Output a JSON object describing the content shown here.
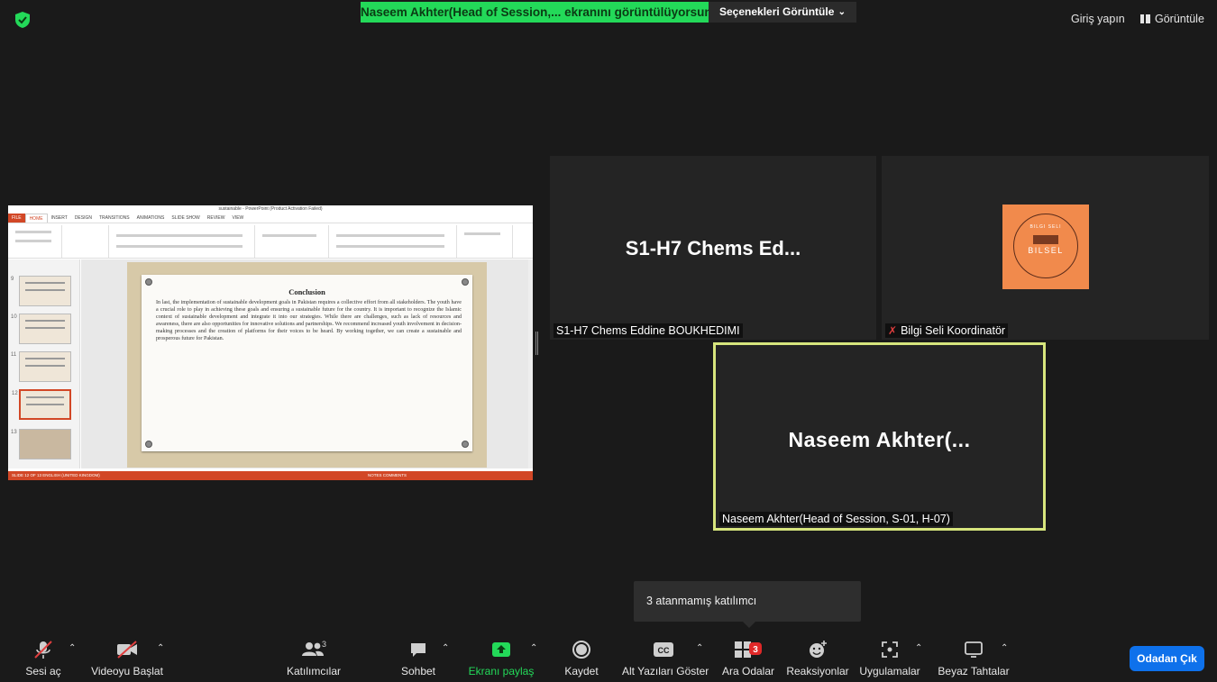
{
  "top": {
    "share_banner": "Naseem Akhter(Head of Session,... ekranını görüntülüyorsunuz",
    "view_options": "Seçenekleri Görüntüle",
    "sign_in": "Giriş yapın",
    "view": "Görüntüle",
    "colors": {
      "banner": "#23d959",
      "background": "#1a1a1a"
    }
  },
  "shared_screen": {
    "app_title": "sustainable - PowerPoint (Product Activation Failed)",
    "tabs": [
      "FILE",
      "HOME",
      "INSERT",
      "DESIGN",
      "TRANSITIONS",
      "ANIMATIONS",
      "SLIDE SHOW",
      "REVIEW",
      "VIEW"
    ],
    "slide_title": "Conclusion",
    "slide_body": "In last, the implementation of sustainable development goals in Pakistan requires a collective effort from all stakeholders. The youth have a crucial role to play in achieving these goals and ensuring a sustainable future for the country. It is important to recognize the Islamic context of sustainable development and integrate it into our strategies. While there are challenges, such as lack of resources and awareness, there are also opportunities for innovative solutions and partnerships. We recommend increased youth involvement in decision-making processes and the creation of platforms for their voices to be heard. By working together, we can create a sustainable and prosperous future for Pakistan.",
    "thumb_numbers": [
      "9",
      "10",
      "11",
      "12",
      "13"
    ],
    "status_text": "SLIDE 12 OF 13    ENGLISH (UNITED KINGDOM)",
    "status_right": "NOTES   COMMENTS"
  },
  "participants": [
    {
      "big": "S1-H7 Chems Ed...",
      "name": "S1-H7 Chems Eddine BOUKHEDIMI"
    },
    {
      "name": "Bilgi Seli Koordinatör",
      "logo_top": "BILGI SELI",
      "logo_main": "BILSEL"
    },
    {
      "big": "Naseem Akhter(...",
      "name": "Naseem Akhter(Head of Session, S-01, H-07)",
      "active_speaker_color": "#d7e57d"
    }
  ],
  "tooltip": "3 atanmamış katılımcı",
  "toolbar": {
    "unmute": "Sesi aç",
    "start_video": "Videoyu Başlat",
    "participants": "Katılımcılar",
    "participants_count": "3",
    "chat": "Sohbet",
    "share_screen": "Ekranı paylaş",
    "record": "Kaydet",
    "captions": "Alt Yazıları Göster",
    "captions_badge": "CC",
    "breakout": "Ara Odalar",
    "breakout_badge": "3",
    "reactions": "Reaksiyonlar",
    "apps": "Uygulamalar",
    "whiteboards": "Beyaz Tahtalar",
    "leave": "Odadan Çık"
  }
}
